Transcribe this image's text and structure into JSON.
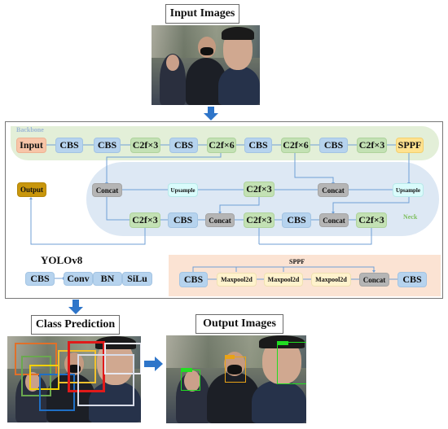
{
  "input_section": {
    "title": "Input Images",
    "image_alt": "street scene with three people, one wearing a black face mask"
  },
  "architecture": {
    "backbone_label": "Backbone",
    "neck_label": "Neck",
    "backbone_row": [
      "Input",
      "CBS",
      "CBS",
      "C2f×3",
      "CBS",
      "C2f×6",
      "CBS",
      "C2f×6",
      "CBS",
      "C2f×3",
      "SPPF"
    ],
    "neck_top_row": [
      "Concat",
      "Upsample",
      "C2f×3",
      "Concat",
      "Upsample"
    ],
    "neck_bottom_row": [
      "C2f×3",
      "CBS",
      "Concat",
      "C2f×3",
      "CBS",
      "Concat",
      "C2f×3"
    ],
    "output_label": "Output",
    "model_name": "YOLOv8",
    "cbs_definition": [
      "CBS",
      "Conv",
      "BN",
      "SiLu"
    ],
    "sppf_title": "SPPF",
    "sppf_row": [
      "CBS",
      "Maxpool2d",
      "Maxpool2d",
      "Maxpool2d",
      "Concat",
      "CBS"
    ]
  },
  "prediction_section": {
    "title": "Class Prediction",
    "box_colors": [
      "#e0702a",
      "#6aa84f",
      "#f4d000",
      "#1f6fc4",
      "#f2c12e",
      "#e01a1a",
      "#e8e8f0",
      "#d8dce8"
    ]
  },
  "output_section": {
    "title": "Output Images",
    "detections": [
      {
        "color": "#22dd22"
      },
      {
        "color": "#e8a317"
      },
      {
        "color": "#22dd22"
      }
    ]
  },
  "colors": {
    "arrow_blue": "#2e75c9",
    "backbone_bg": "#e3efd8",
    "neck_bg": "#dde8f4",
    "sppf_bg": "#fbe3d3",
    "wire": "#6f9fd6"
  }
}
